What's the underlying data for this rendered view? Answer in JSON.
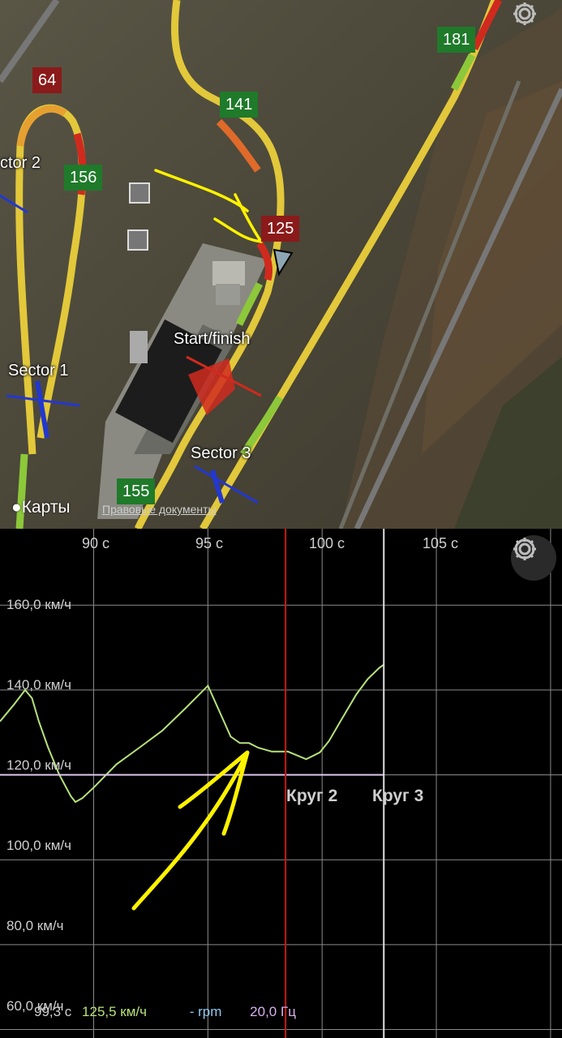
{
  "map": {
    "speed_markers": [
      {
        "value": "64",
        "color": "red"
      },
      {
        "value": "156",
        "color": "green"
      },
      {
        "value": "141",
        "color": "green"
      },
      {
        "value": "125",
        "color": "red"
      },
      {
        "value": "181",
        "color": "green"
      },
      {
        "value": "155",
        "color": "green"
      }
    ],
    "labels": {
      "sector2": "ctor 2",
      "sector1": "Sector 1",
      "sector3": "Sector 3",
      "start_finish": "Start/finish"
    },
    "attribution": "Карты",
    "legal_link": "Правовые документы"
  },
  "chart_data": {
    "type": "line",
    "x_ticks": [
      "90 с",
      "95 с",
      "100 с",
      "105 с"
    ],
    "y_ticks": [
      "160,0 км/ч",
      "140,0 км/ч",
      "120,0 км/ч",
      "100,0 км/ч",
      "80,0 км/ч",
      "60,0 км/ч"
    ],
    "x_unit": "s",
    "y_unit": "km/h",
    "xlim": [
      85.9,
      110.5
    ],
    "ylim": [
      58,
      178
    ],
    "series": [
      {
        "color": "#b7e27a",
        "x": [
          85.9,
          86.5,
          87.0,
          87.3,
          87.6,
          88.0,
          88.5,
          89.0,
          89.2,
          89.5,
          90.0,
          91.0,
          92.0,
          93.0,
          94.0,
          95.0,
          96.0,
          96.4,
          96.8,
          97.2,
          97.8,
          98.5,
          99.3,
          99.9,
          100.3,
          100.8,
          101.5,
          102.0,
          102.5,
          102.7
        ],
        "y": [
          132.6,
          136.5,
          140.0,
          138.1,
          132.6,
          126.5,
          120.0,
          115.0,
          113.6,
          114.5,
          117.0,
          122.5,
          126.4,
          130.4,
          135.6,
          141.0,
          129.0,
          127.5,
          127.5,
          126.4,
          125.5,
          125.5,
          123.7,
          125.3,
          128.0,
          132.6,
          139.0,
          142.6,
          145.2,
          146.0
        ]
      }
    ],
    "reference_line": {
      "y": 120.0,
      "x_end": 102.7,
      "color": "#e0c8f0"
    },
    "cursor_x": 98.4,
    "lap_boundary_x": 102.7,
    "lap_labels": [
      "Круг 2",
      "Круг 3"
    ]
  },
  "readout": {
    "time": "99,3 с",
    "speed": "125,5 км/ч",
    "rpm": "- rpm",
    "freq": "20,0 Гц",
    "time_color": "#d0d0d0",
    "speed_color": "#b7e27a",
    "rpm_color": "#8ec8f0",
    "freq_color": "#d9b0f0"
  }
}
